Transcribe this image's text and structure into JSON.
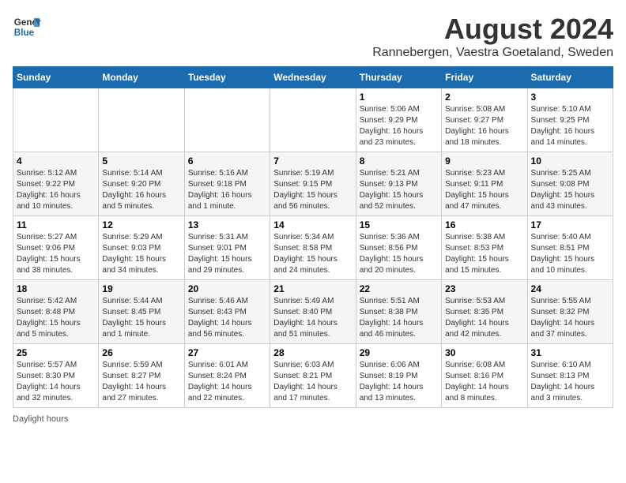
{
  "logo": {
    "line1": "General",
    "line2": "Blue"
  },
  "title": {
    "month_year": "August 2024",
    "location": "Rannebergen, Vaestra Goetaland, Sweden"
  },
  "days_of_week": [
    "Sunday",
    "Monday",
    "Tuesday",
    "Wednesday",
    "Thursday",
    "Friday",
    "Saturday"
  ],
  "weeks": [
    [
      {
        "day": "",
        "info": ""
      },
      {
        "day": "",
        "info": ""
      },
      {
        "day": "",
        "info": ""
      },
      {
        "day": "",
        "info": ""
      },
      {
        "day": "1",
        "info": "Sunrise: 5:06 AM\nSunset: 9:29 PM\nDaylight: 16 hours and 23 minutes."
      },
      {
        "day": "2",
        "info": "Sunrise: 5:08 AM\nSunset: 9:27 PM\nDaylight: 16 hours and 18 minutes."
      },
      {
        "day": "3",
        "info": "Sunrise: 5:10 AM\nSunset: 9:25 PM\nDaylight: 16 hours and 14 minutes."
      }
    ],
    [
      {
        "day": "4",
        "info": "Sunrise: 5:12 AM\nSunset: 9:22 PM\nDaylight: 16 hours and 10 minutes."
      },
      {
        "day": "5",
        "info": "Sunrise: 5:14 AM\nSunset: 9:20 PM\nDaylight: 16 hours and 5 minutes."
      },
      {
        "day": "6",
        "info": "Sunrise: 5:16 AM\nSunset: 9:18 PM\nDaylight: 16 hours and 1 minute."
      },
      {
        "day": "7",
        "info": "Sunrise: 5:19 AM\nSunset: 9:15 PM\nDaylight: 15 hours and 56 minutes."
      },
      {
        "day": "8",
        "info": "Sunrise: 5:21 AM\nSunset: 9:13 PM\nDaylight: 15 hours and 52 minutes."
      },
      {
        "day": "9",
        "info": "Sunrise: 5:23 AM\nSunset: 9:11 PM\nDaylight: 15 hours and 47 minutes."
      },
      {
        "day": "10",
        "info": "Sunrise: 5:25 AM\nSunset: 9:08 PM\nDaylight: 15 hours and 43 minutes."
      }
    ],
    [
      {
        "day": "11",
        "info": "Sunrise: 5:27 AM\nSunset: 9:06 PM\nDaylight: 15 hours and 38 minutes."
      },
      {
        "day": "12",
        "info": "Sunrise: 5:29 AM\nSunset: 9:03 PM\nDaylight: 15 hours and 34 minutes."
      },
      {
        "day": "13",
        "info": "Sunrise: 5:31 AM\nSunset: 9:01 PM\nDaylight: 15 hours and 29 minutes."
      },
      {
        "day": "14",
        "info": "Sunrise: 5:34 AM\nSunset: 8:58 PM\nDaylight: 15 hours and 24 minutes."
      },
      {
        "day": "15",
        "info": "Sunrise: 5:36 AM\nSunset: 8:56 PM\nDaylight: 15 hours and 20 minutes."
      },
      {
        "day": "16",
        "info": "Sunrise: 5:38 AM\nSunset: 8:53 PM\nDaylight: 15 hours and 15 minutes."
      },
      {
        "day": "17",
        "info": "Sunrise: 5:40 AM\nSunset: 8:51 PM\nDaylight: 15 hours and 10 minutes."
      }
    ],
    [
      {
        "day": "18",
        "info": "Sunrise: 5:42 AM\nSunset: 8:48 PM\nDaylight: 15 hours and 5 minutes."
      },
      {
        "day": "19",
        "info": "Sunrise: 5:44 AM\nSunset: 8:45 PM\nDaylight: 15 hours and 1 minute."
      },
      {
        "day": "20",
        "info": "Sunrise: 5:46 AM\nSunset: 8:43 PM\nDaylight: 14 hours and 56 minutes."
      },
      {
        "day": "21",
        "info": "Sunrise: 5:49 AM\nSunset: 8:40 PM\nDaylight: 14 hours and 51 minutes."
      },
      {
        "day": "22",
        "info": "Sunrise: 5:51 AM\nSunset: 8:38 PM\nDaylight: 14 hours and 46 minutes."
      },
      {
        "day": "23",
        "info": "Sunrise: 5:53 AM\nSunset: 8:35 PM\nDaylight: 14 hours and 42 minutes."
      },
      {
        "day": "24",
        "info": "Sunrise: 5:55 AM\nSunset: 8:32 PM\nDaylight: 14 hours and 37 minutes."
      }
    ],
    [
      {
        "day": "25",
        "info": "Sunrise: 5:57 AM\nSunset: 8:30 PM\nDaylight: 14 hours and 32 minutes."
      },
      {
        "day": "26",
        "info": "Sunrise: 5:59 AM\nSunset: 8:27 PM\nDaylight: 14 hours and 27 minutes."
      },
      {
        "day": "27",
        "info": "Sunrise: 6:01 AM\nSunset: 8:24 PM\nDaylight: 14 hours and 22 minutes."
      },
      {
        "day": "28",
        "info": "Sunrise: 6:03 AM\nSunset: 8:21 PM\nDaylight: 14 hours and 17 minutes."
      },
      {
        "day": "29",
        "info": "Sunrise: 6:06 AM\nSunset: 8:19 PM\nDaylight: 14 hours and 13 minutes."
      },
      {
        "day": "30",
        "info": "Sunrise: 6:08 AM\nSunset: 8:16 PM\nDaylight: 14 hours and 8 minutes."
      },
      {
        "day": "31",
        "info": "Sunrise: 6:10 AM\nSunset: 8:13 PM\nDaylight: 14 hours and 3 minutes."
      }
    ]
  ],
  "footer": {
    "daylight_label": "Daylight hours"
  }
}
